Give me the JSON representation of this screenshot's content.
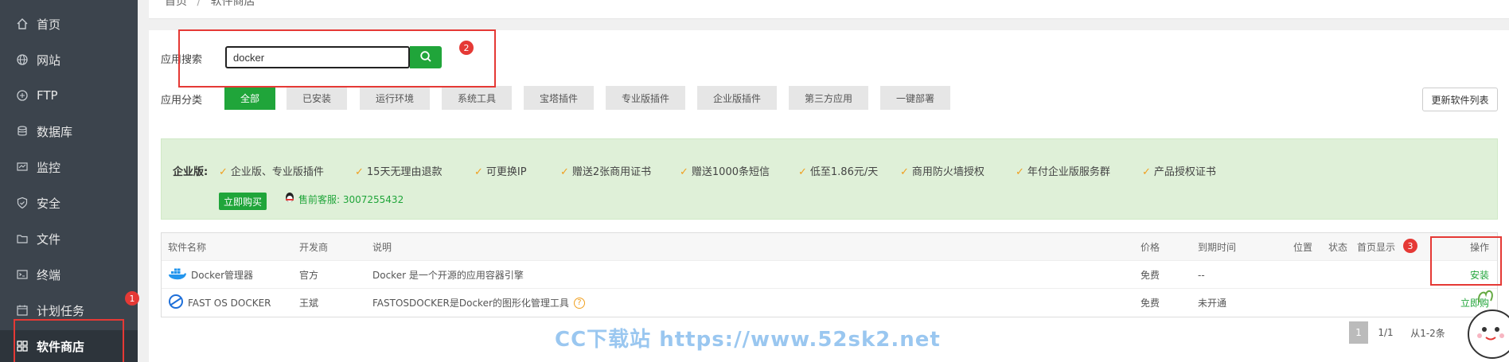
{
  "sidebar": {
    "items": [
      {
        "label": "首页",
        "icon": "home-icon"
      },
      {
        "label": "网站",
        "icon": "globe-icon"
      },
      {
        "label": "FTP",
        "icon": "ftp-icon"
      },
      {
        "label": "数据库",
        "icon": "database-icon"
      },
      {
        "label": "监控",
        "icon": "monitor-icon"
      },
      {
        "label": "安全",
        "icon": "shield-icon"
      },
      {
        "label": "文件",
        "icon": "folder-icon"
      },
      {
        "label": "终端",
        "icon": "terminal-icon"
      },
      {
        "label": "计划任务",
        "icon": "clock-icon"
      },
      {
        "label": "软件商店",
        "icon": "grid-icon",
        "active": true
      }
    ]
  },
  "breadcrumb": {
    "home": "首页",
    "sep": "/",
    "current": "软件商店"
  },
  "search": {
    "label": "应用搜索",
    "value": "docker"
  },
  "categories": {
    "label": "应用分类",
    "items": [
      "全部",
      "已安装",
      "运行环境",
      "系统工具",
      "宝塔插件",
      "专业版插件",
      "企业版插件",
      "第三方应用",
      "一键部署"
    ],
    "active_index": 0
  },
  "refresh_label": "更新软件列表",
  "promo": {
    "title": "企业版:",
    "features": [
      "企业版、专业版插件",
      "15天无理由退款",
      "可更换IP",
      "赠送2张商用证书",
      "赠送1000条短信",
      "低至1.86元/天",
      "商用防火墙授权",
      "年付企业版服务群",
      "产品授权证书"
    ],
    "buy_label": "立即购买",
    "qq_text": "售前客服: 3007255432"
  },
  "table": {
    "headers": [
      "软件名称",
      "开发商",
      "说明",
      "价格",
      "到期时间",
      "位置",
      "状态",
      "首页显示",
      "操作"
    ],
    "rows": [
      {
        "name": "Docker管理器",
        "dev": "官方",
        "desc": "Docker 是一个开源的应用容器引擎",
        "price": "免费",
        "expire": "--",
        "action": "安装"
      },
      {
        "name": "FAST OS DOCKER",
        "dev": "王斌",
        "desc": "FASTOSDOCKER是Docker的图形化管理工具",
        "price": "免费",
        "expire": "未开通",
        "action": "立即购"
      }
    ]
  },
  "pager": {
    "current": "1",
    "pages": "1/1",
    "range": "从1-2条"
  },
  "annotations": {
    "n1": "1",
    "n2": "2",
    "n3": "3"
  },
  "watermark": "CC下载站 https://www.52sk2.net",
  "colors": {
    "accent": "#20a53a",
    "sidebar": "#3c444d",
    "annotation": "#e53935"
  }
}
